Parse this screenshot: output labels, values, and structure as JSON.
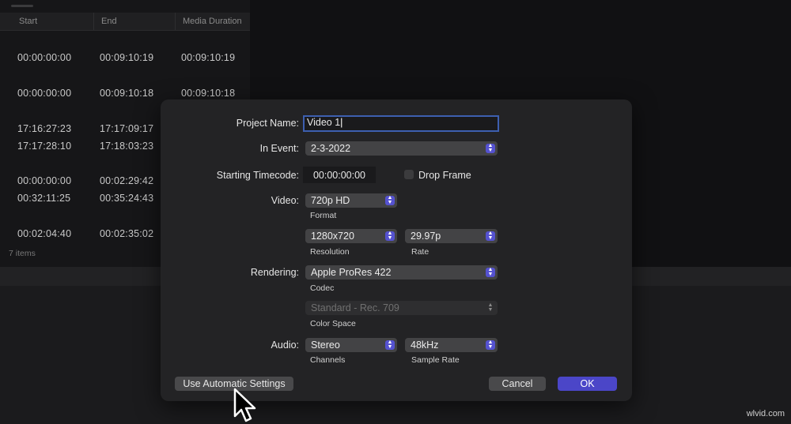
{
  "browser": {
    "columns": [
      "Start",
      "End",
      "Media Duration"
    ],
    "rows": [
      {
        "start": "00:00:00:00",
        "end": "00:09:10:19",
        "duration": "00:09:10:19"
      },
      {
        "start": "00:00:00:00",
        "end": "00:09:10:18",
        "duration": "00:09:10:18"
      },
      {
        "start": "17:16:27:23",
        "end": "17:17:09:17",
        "duration": ""
      },
      {
        "start": "17:17:28:10",
        "end": "17:18:03:23",
        "duration": ""
      },
      {
        "start": "00:00:00:00",
        "end": "00:02:29:42",
        "duration": ""
      },
      {
        "start": "00:32:11:25",
        "end": "00:35:24:43",
        "duration": ""
      },
      {
        "start": "00:02:04:40",
        "end": "00:02:35:02",
        "duration": ""
      }
    ],
    "item_count": "7 items"
  },
  "dialog": {
    "project_name_label": "Project Name:",
    "project_name_value": "Video 1",
    "in_event_label": "In Event:",
    "in_event_value": "2-3-2022",
    "starting_timecode_label": "Starting Timecode:",
    "starting_timecode_value": "00:00:00:00",
    "drop_frame_label": "Drop Frame",
    "video_label": "Video:",
    "format_value": "720p HD",
    "format_caption": "Format",
    "resolution_value": "1280x720",
    "resolution_caption": "Resolution",
    "rate_value": "29.97p",
    "rate_caption": "Rate",
    "rendering_label": "Rendering:",
    "codec_value": "Apple ProRes 422",
    "codec_caption": "Codec",
    "color_space_value": "Standard - Rec. 709",
    "color_space_caption": "Color Space",
    "audio_label": "Audio:",
    "channels_value": "Stereo",
    "channels_caption": "Channels",
    "sample_rate_value": "48kHz",
    "sample_rate_caption": "Sample Rate",
    "auto_settings_button": "Use Automatic Settings",
    "cancel_button": "Cancel",
    "ok_button": "OK"
  },
  "watermark": "wlvid.com",
  "colors": {
    "accent": "#4b46c8",
    "focus_ring": "#3d5fb0",
    "dialog_bg": "#232325"
  },
  "icons": [
    "chevron-updown-icon",
    "pointer-cursor-icon"
  ]
}
